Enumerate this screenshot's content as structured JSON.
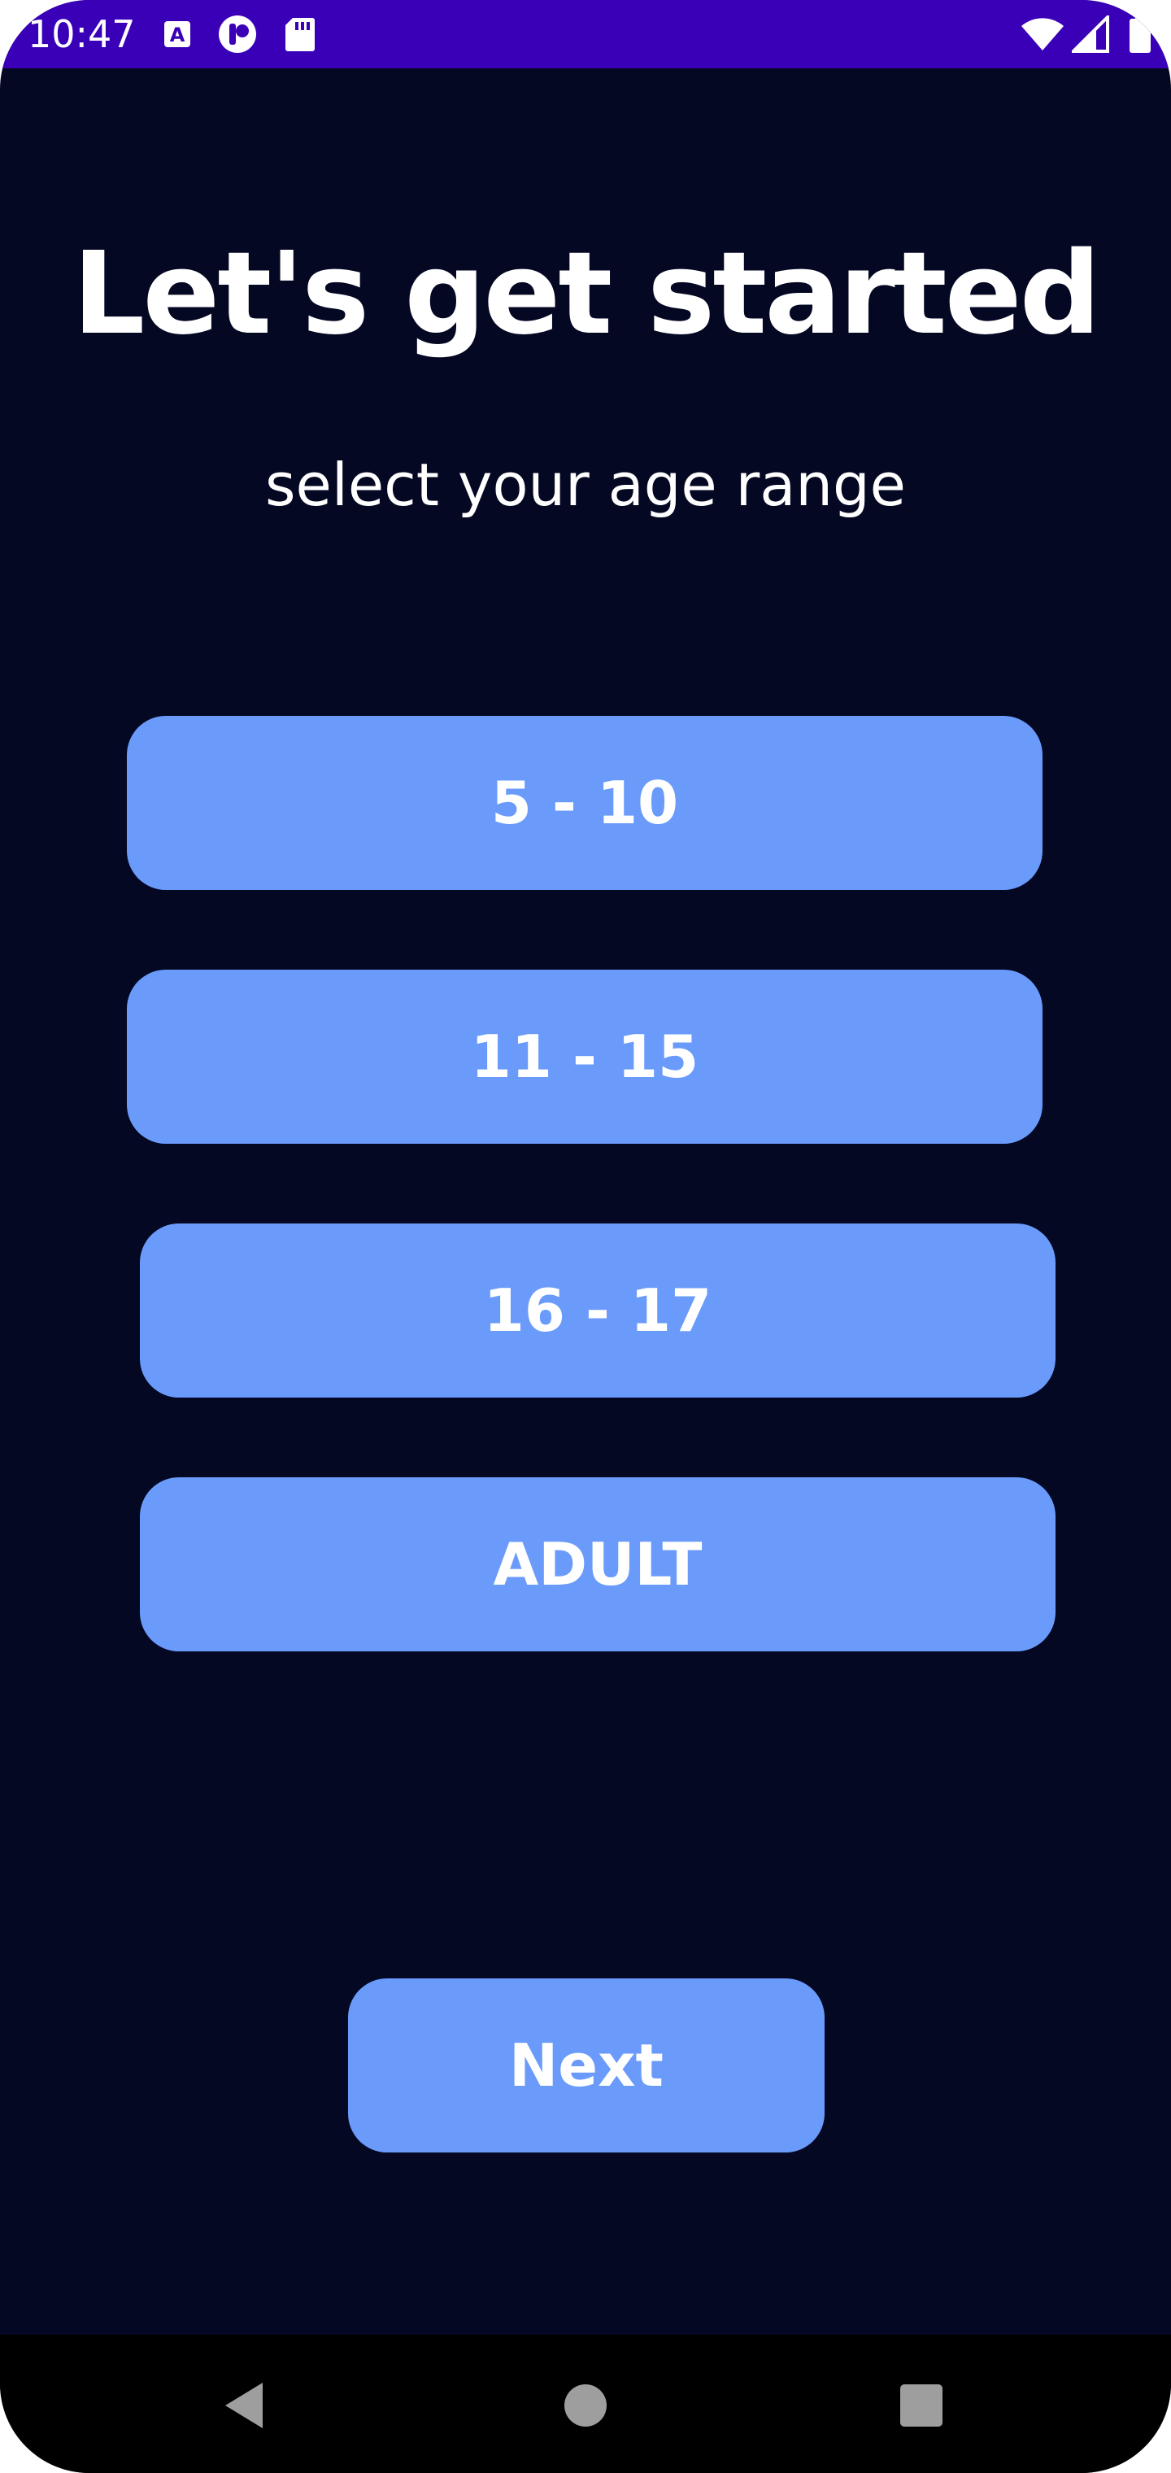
{
  "status_bar": {
    "time": "10:47",
    "icons": [
      "a-notification-icon",
      "app-notification-icon",
      "sd-card-icon",
      "wifi-icon",
      "signal-icon",
      "battery-icon"
    ],
    "color": "#3a00b8"
  },
  "header": {
    "title": "Let's get started",
    "subtitle": "select your age range"
  },
  "age_options": [
    {
      "label": "5 - 10"
    },
    {
      "label": "11 - 15"
    },
    {
      "label": "16 - 17"
    },
    {
      "label": "ADULT"
    }
  ],
  "actions": {
    "next_label": "Next"
  },
  "nav_bar": {
    "icons": [
      "back-icon",
      "home-icon",
      "recents-icon"
    ]
  },
  "colors": {
    "background": "#040823",
    "button": "#6a9bfb",
    "text": "#ffffff"
  }
}
